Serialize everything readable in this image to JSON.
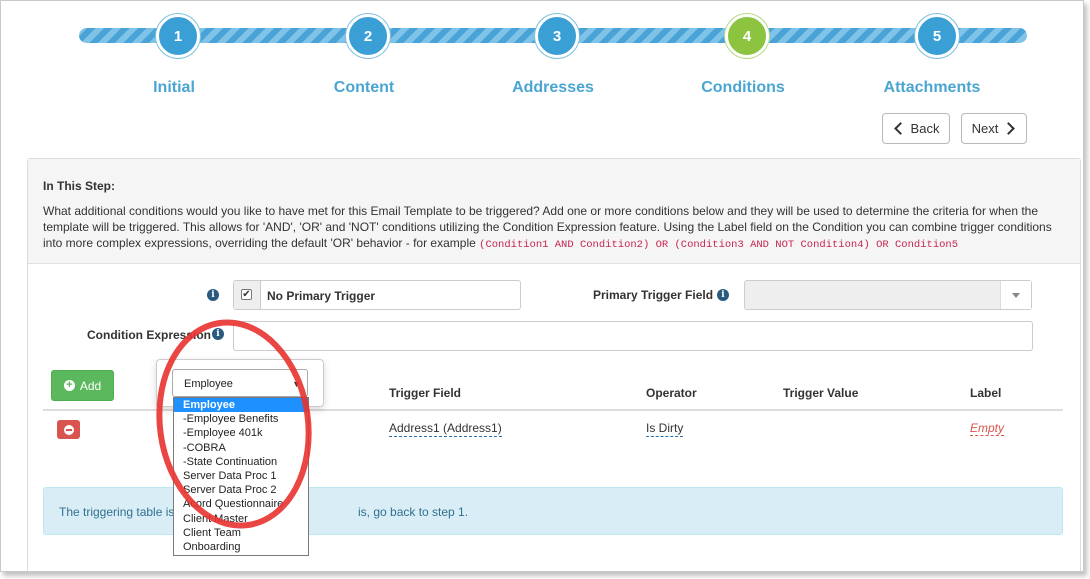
{
  "wizard": {
    "steps": [
      {
        "number": "1",
        "label": "Initial"
      },
      {
        "number": "2",
        "label": "Content"
      },
      {
        "number": "3",
        "label": "Addresses"
      },
      {
        "number": "4",
        "label": "Conditions"
      },
      {
        "number": "5",
        "label": "Attachments"
      }
    ],
    "active_step": "4",
    "back_label": "Back",
    "next_label": "Next"
  },
  "panel": {
    "title": "In This Step:",
    "description_1": "What additional conditions would you like to have met for this Email Template to be triggered? Add one or more conditions below and they will be used to determine the criteria for when the template will be triggered. This allows for 'AND', 'OR' and 'NOT' conditions utilizing the Condition Expression feature. Using the Label field on the Condition you can combine trigger conditions into more complex expressions, overriding the default 'OR' behavior - for example",
    "example_expression": "(Condition1 AND Condition2) OR (Condition3 AND NOT Condition4) OR Condition5"
  },
  "form": {
    "no_primary_trigger_label": "No Primary Trigger",
    "no_primary_trigger_checked": true,
    "primary_trigger_field_label": "Primary Trigger Field",
    "primary_trigger_field_value": "",
    "condition_expression_label": "Condition Expression",
    "condition_expression_value": ""
  },
  "table": {
    "add_label": "Add",
    "columns": [
      "Trigger Field",
      "Operator",
      "Trigger Value",
      "Label"
    ],
    "rows": [
      {
        "trigger_field": "Address1 (Address1)",
        "operator": "Is Dirty",
        "trigger_value": "",
        "label": "Empty"
      }
    ]
  },
  "alert": {
    "text_left": "The triggering table is",
    "text_right": "is, go back to step 1."
  },
  "table_dropdown": {
    "selected": "Employee",
    "options": [
      "Employee",
      "-Employee Benefits",
      "-Employee 401k",
      "-COBRA",
      "-State Continuation",
      "Server Data Proc 1",
      "Server Data Proc 2",
      "Acord Questionnaire",
      "Client Master",
      "Client Team",
      "Onboarding"
    ]
  },
  "colors": {
    "step_blue": "#3a9fd4",
    "step_active_green": "#8cc43f",
    "annotation_red": "#e8322f",
    "add_green": "#5cb85c",
    "remove_red": "#d9534f"
  },
  "icons": [
    "info-icon",
    "checkbox-icon",
    "chevron-left-icon",
    "chevron-right-icon",
    "plus-circle-icon",
    "minus-circle-icon",
    "caret-down-icon"
  ]
}
